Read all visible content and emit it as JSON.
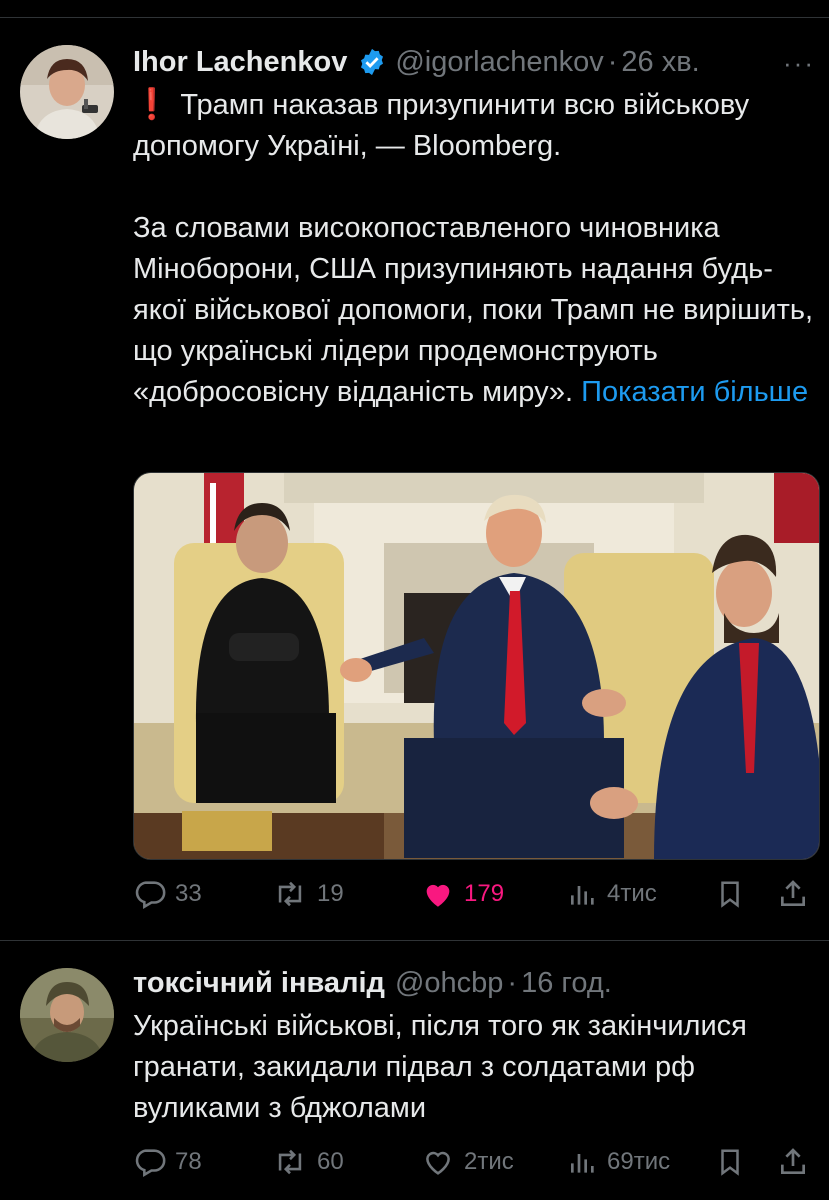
{
  "tweets": [
    {
      "author_name": "Ihor Lachenkov",
      "handle": "@igorlachenkov",
      "separator": "·",
      "time": "26 хв.",
      "more": "···",
      "alert_icon": "❗",
      "headline": "Трамп наказав призупинити всю військову допомогу Україні, — Bloomberg.",
      "body": "За словами високопоставленого чиновника Міноборони, США призупиняють надання будь-якої військової допомоги, поки Трамп не вирішить, що українські лідери продемонструють «добросовісну відданість миру».",
      "show_more": "Показати більше",
      "replies": "33",
      "reposts": "19",
      "likes": "179",
      "views": "4тис",
      "liked": true,
      "icons": [
        "reply-icon",
        "repost-icon",
        "heart-icon",
        "views-icon",
        "bookmark-icon",
        "share-icon"
      ]
    },
    {
      "author_name": "токсічний інвалід",
      "handle": "@ohcbp",
      "separator": "·",
      "time": "16 год.",
      "body": "Українські військові, після того як закінчилися гранати, закидали підвал з солдатами рф вуликами з бджолами",
      "replies": "78",
      "reposts": "60",
      "likes": "2тис",
      "views": "69тис",
      "liked": false
    }
  ],
  "colors": {
    "background": "#000000",
    "text": "#e7e9ea",
    "muted": "#71767b",
    "link": "#1d9bf0",
    "like": "#f91880",
    "verified": "#1d9bf0",
    "alert": "#f4212e"
  }
}
